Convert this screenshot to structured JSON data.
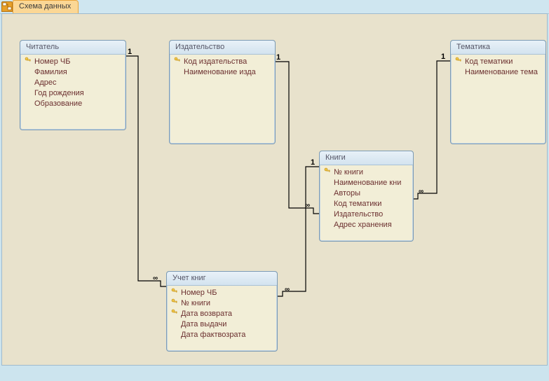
{
  "tab": {
    "title": "Схема данных"
  },
  "entities": {
    "reader": {
      "title": "Читатель",
      "fields": [
        {
          "key": true,
          "label": "Номер ЧБ"
        },
        {
          "key": false,
          "label": "Фамилия"
        },
        {
          "key": false,
          "label": "Адрес"
        },
        {
          "key": false,
          "label": "Год рождения"
        },
        {
          "key": false,
          "label": "Образование"
        }
      ]
    },
    "publisher": {
      "title": "Издательство",
      "fields": [
        {
          "key": true,
          "label": "Код издательства"
        },
        {
          "key": false,
          "label": "Наименование изда"
        }
      ]
    },
    "topic": {
      "title": "Тематика",
      "fields": [
        {
          "key": true,
          "label": "Код тематики"
        },
        {
          "key": false,
          "label": "Наименование тема"
        }
      ]
    },
    "books": {
      "title": "Книги",
      "fields": [
        {
          "key": true,
          "label": "№ книги"
        },
        {
          "key": false,
          "label": "Наименование кни"
        },
        {
          "key": false,
          "label": "Авторы"
        },
        {
          "key": false,
          "label": "Код тематики"
        },
        {
          "key": false,
          "label": "Издательство"
        },
        {
          "key": false,
          "label": "Адрес хранения"
        }
      ]
    },
    "ledger": {
      "title": "Учет книг",
      "fields": [
        {
          "key": true,
          "label": "Номер ЧБ"
        },
        {
          "key": true,
          "label": "№ книги"
        },
        {
          "key": true,
          "label": "Дата возврата"
        },
        {
          "key": false,
          "label": "Дата выдачи"
        },
        {
          "key": false,
          "label": "Дата фактвозрата"
        }
      ]
    }
  },
  "cardinality": {
    "one": "1",
    "many": "∞"
  }
}
